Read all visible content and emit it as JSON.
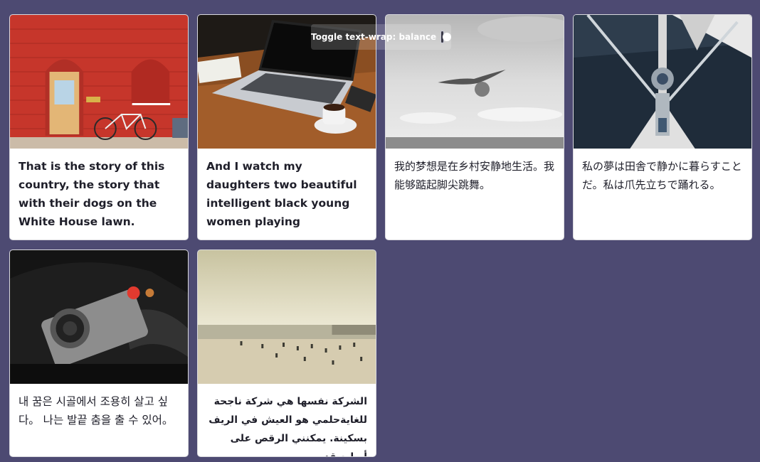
{
  "toggle": {
    "label": "Toggle text-wrap: balance",
    "state": "off"
  },
  "cards": [
    {
      "image": "red-brick-building-with-bicycle",
      "text": "That is the story of this country, the story that with their dogs on the White House lawn."
    },
    {
      "image": "laptop-on-wooden-desk-with-coffee",
      "text": "And I watch my daughters two beautiful intelligent black young women playing"
    },
    {
      "image": "seagull-over-sea-grayscale",
      "text": "我的梦想是在乡村安静地生活。我能够踮起脚尖跳舞。"
    },
    {
      "image": "sailboat-mast-and-rigging",
      "text": "私の夢は田舎で静かに暮らすことだ。私は爪先立ちで踊れる。"
    },
    {
      "image": "vintage-camera-on-jacket",
      "text": "내 꿈은 시골에서 조용히 살고 싶다。 나는 발끝 춤을 출 수 있어。"
    },
    {
      "image": "crowded-beach-sepia",
      "text": "الشركة نفسها هي شركة ناجحة للغايةحلمي هو العيش في الريف بسكينة. يمكنني الرقص على أصابع قدمي."
    }
  ]
}
